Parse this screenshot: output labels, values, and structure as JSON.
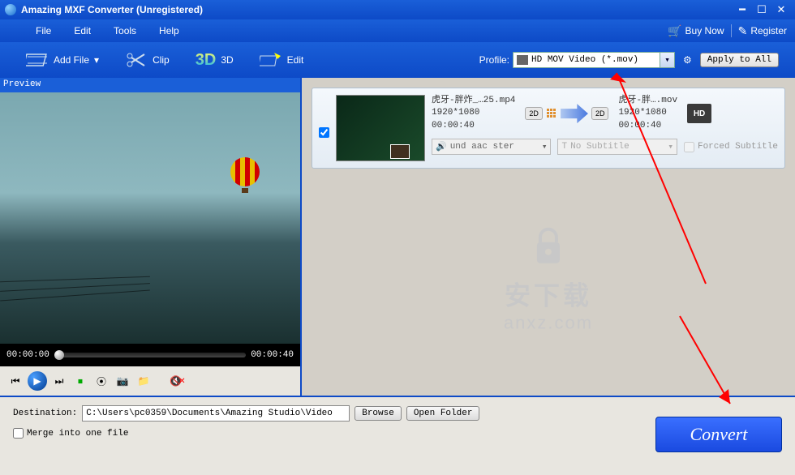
{
  "titlebar": {
    "title": "Amazing MXF Converter (Unregistered)"
  },
  "menubar": {
    "file": "File",
    "edit": "Edit",
    "tools": "Tools",
    "help": "Help",
    "buy": "Buy Now",
    "register": "Register"
  },
  "toolbar": {
    "add_file": "Add File",
    "clip": "Clip",
    "three_d": "3D",
    "edit": "Edit",
    "profile_label": "Profile:",
    "profile_value": "HD MOV Video (*.mov)",
    "apply_all": "Apply to All"
  },
  "preview": {
    "header": "Preview",
    "time_current": "00:00:00",
    "time_total": "00:00:40"
  },
  "item": {
    "src_name": "虎牙-胖炸_…25.mp4",
    "src_res": "1920*1080",
    "src_dur": "00:00:40",
    "out_name": "虎牙-胖….mov",
    "out_res": "1920*1080",
    "out_dur": "00:00:40",
    "badge_in": "2D",
    "badge_out": "2D",
    "hd": "HD",
    "audio": "und aac ster",
    "subtitle": "No Subtitle",
    "forced": "Forced Subtitle"
  },
  "watermark": {
    "zh": "安下载",
    "en": "anxz.com"
  },
  "bottom": {
    "dest_label": "Destination:",
    "dest_path": "C:\\Users\\pc0359\\Documents\\Amazing Studio\\Video",
    "browse": "Browse",
    "open_folder": "Open Folder",
    "merge": "Merge into one file",
    "convert": "Convert"
  }
}
